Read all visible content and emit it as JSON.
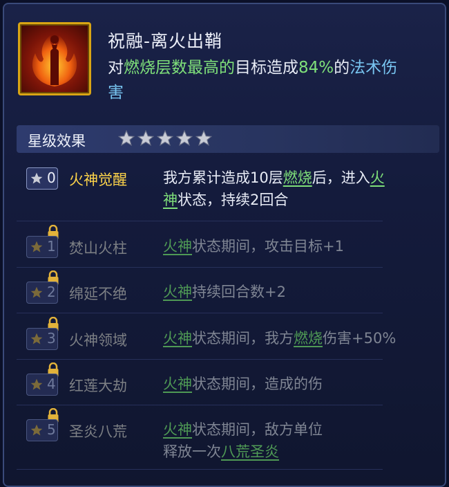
{
  "skill": {
    "title": "祝融-离火出鞘",
    "desc": {
      "p1": "对",
      "k1": "燃烧层数最高的",
      "p2": "目标造成",
      "k2": "84%",
      "p3": "的",
      "k3": "法术伤",
      "p4": "害"
    },
    "icon": "fire-deity-icon"
  },
  "star_section": {
    "title": "星级效果",
    "star_count": 5
  },
  "rows": [
    {
      "level": "0",
      "name": "火神觉醒",
      "active": true,
      "d1": "我方累计造成10层",
      "k1": "燃烧",
      "d2": "后，进入",
      "k2": "火",
      "k3": "神",
      "d3": "状态，持续2回合"
    },
    {
      "level": "1",
      "name": "焚山火柱",
      "active": false,
      "k1": "火神",
      "d1": "状态期间，攻击目标+1"
    },
    {
      "level": "2",
      "name": "绵延不绝",
      "active": false,
      "k1": "火神",
      "d1": "持续回合数+2"
    },
    {
      "level": "3",
      "name": "火神领域",
      "active": false,
      "k1": "火神",
      "d1": "状态期间，我方",
      "k2": "燃烧",
      "d2": "伤害+50%"
    },
    {
      "level": "4",
      "name": "红莲大劫",
      "active": false,
      "k1": "火神",
      "d1": "状态期间，造成的伤"
    },
    {
      "level": "5",
      "name": "圣炎八荒",
      "active": false,
      "k1": "火神",
      "d1": "状态期间，敌方单位",
      "d2": "释放一次",
      "k2": "八荒圣炎"
    }
  ],
  "colors": {
    "gold": "#ffd54a",
    "green": "#7fe07a",
    "blue": "#78c4f0",
    "frame": "#d9a514"
  }
}
